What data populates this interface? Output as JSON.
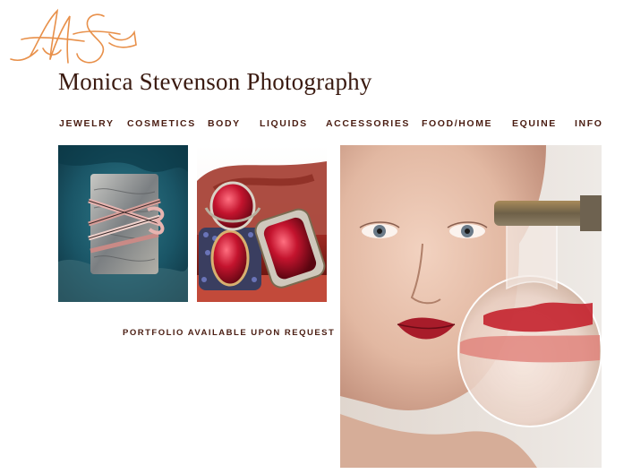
{
  "site": {
    "title": "Monica Stevenson Photography",
    "logo_monogram": "MS",
    "logo_color": "#e8904a",
    "text_color": "#4a1d12"
  },
  "nav": {
    "items": [
      {
        "label": "JEWELRY"
      },
      {
        "label": "COSMETICS"
      },
      {
        "label": "BODY"
      },
      {
        "label": "LIQUIDS"
      },
      {
        "label": "ACCESSORIES"
      },
      {
        "label": "FOOD/HOME"
      },
      {
        "label": "EQUINE"
      },
      {
        "label": "INFO"
      }
    ]
  },
  "main": {
    "portfolio_note": "PORTFOLIO AVAILABLE UPON REQUEST"
  }
}
